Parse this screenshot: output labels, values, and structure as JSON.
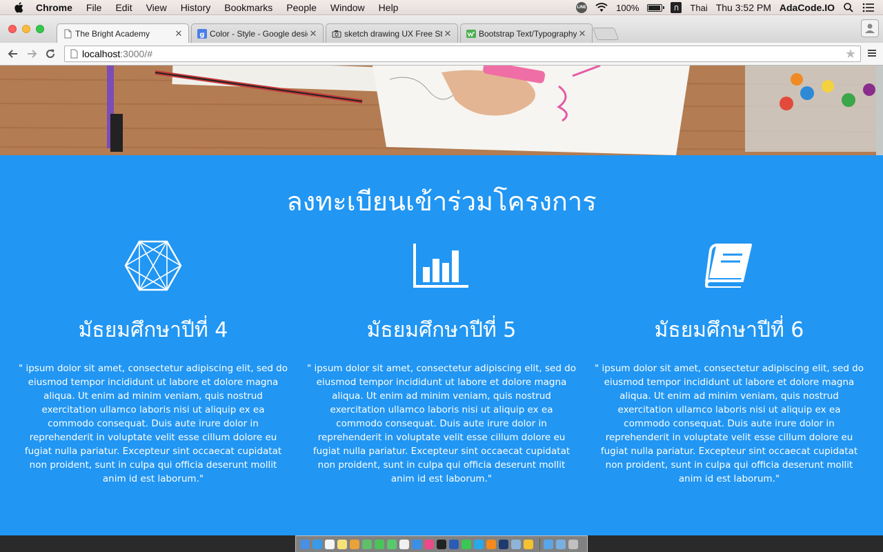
{
  "menubar": {
    "app_name": "Chrome",
    "items": [
      "File",
      "Edit",
      "View",
      "History",
      "Bookmarks",
      "People",
      "Window",
      "Help"
    ],
    "battery_text": "100%",
    "battery_level": 1.0,
    "input_source": "Thai",
    "clock": "Thu 3:52 PM",
    "user": "AdaCode.IO"
  },
  "browser": {
    "tabs": [
      {
        "title": "The Bright Academy",
        "icon": "page-icon",
        "active": true
      },
      {
        "title": "Color - Style - Google design",
        "icon": "google-icon",
        "active": false
      },
      {
        "title": "sketch drawing UX Free Stock",
        "icon": "camera-icon",
        "active": false
      },
      {
        "title": "Bootstrap Text/Typography",
        "icon": "w3-icon",
        "active": false
      }
    ],
    "url_host": "localhost",
    "url_path": ":3000/#"
  },
  "page": {
    "section_title": "ลงทะเบียนเข้าร่วมโครงการ",
    "columns": [
      {
        "icon": "hexagon-network-icon",
        "title": "มัธยมศึกษาปีที่ 4",
        "body": "\" ipsum dolor sit amet, consectetur adipiscing elit, sed do eiusmod tempor incididunt ut labore et dolore magna aliqua. Ut enim ad minim veniam, quis nostrud exercitation ullamco laboris nisi ut aliquip ex ea commodo consequat. Duis aute irure dolor in reprehenderit in voluptate velit esse cillum dolore eu fugiat nulla pariatur. Excepteur sint occaecat cupidatat non proident, sunt in culpa qui officia deserunt mollit anim id est laborum.\""
      },
      {
        "icon": "bar-chart-icon",
        "title": "มัธยมศึกษาปีที่ 5",
        "body": "\" ipsum dolor sit amet, consectetur adipiscing elit, sed do eiusmod tempor incididunt ut labore et dolore magna aliqua. Ut enim ad minim veniam, quis nostrud exercitation ullamco laboris nisi ut aliquip ex ea commodo consequat. Duis aute irure dolor in reprehenderit in voluptate velit esse cillum dolore eu fugiat nulla pariatur. Excepteur sint occaecat cupidatat non proident, sunt in culpa qui officia deserunt mollit anim id est laborum.\""
      },
      {
        "icon": "book-icon",
        "title": "มัธยมศึกษาปีที่ 6",
        "body": "\" ipsum dolor sit amet, consectetur adipiscing elit, sed do eiusmod tempor incididunt ut labore et dolore magna aliqua. Ut enim ad minim veniam, quis nostrud exercitation ullamco laboris nisi ut aliquip ex ea commodo consequat. Duis aute irure dolor in reprehenderit in voluptate velit esse cillum dolore eu fugiat nulla pariatur. Excepteur sint occaecat cupidatat non proident, sunt in culpa qui officia deserunt mollit anim id est laborum.\""
      }
    ]
  },
  "colors": {
    "section_bg": "#2196f3",
    "text": "#ffffff"
  },
  "dock": {
    "apps": [
      "finder-icon",
      "safari-icon",
      "calendar-icon",
      "notes-icon",
      "photos-icon",
      "maps-icon",
      "messages-icon",
      "facetime-icon",
      "textedit-icon",
      "app-store-icon",
      "itunes-icon",
      "terminal-icon",
      "word-icon",
      "line-icon",
      "skype-icon",
      "vlc-icon",
      "photoshop-icon",
      "preview-icon",
      "chrome-icon",
      "folder-icon",
      "downloads-icon",
      "trash-icon"
    ]
  }
}
